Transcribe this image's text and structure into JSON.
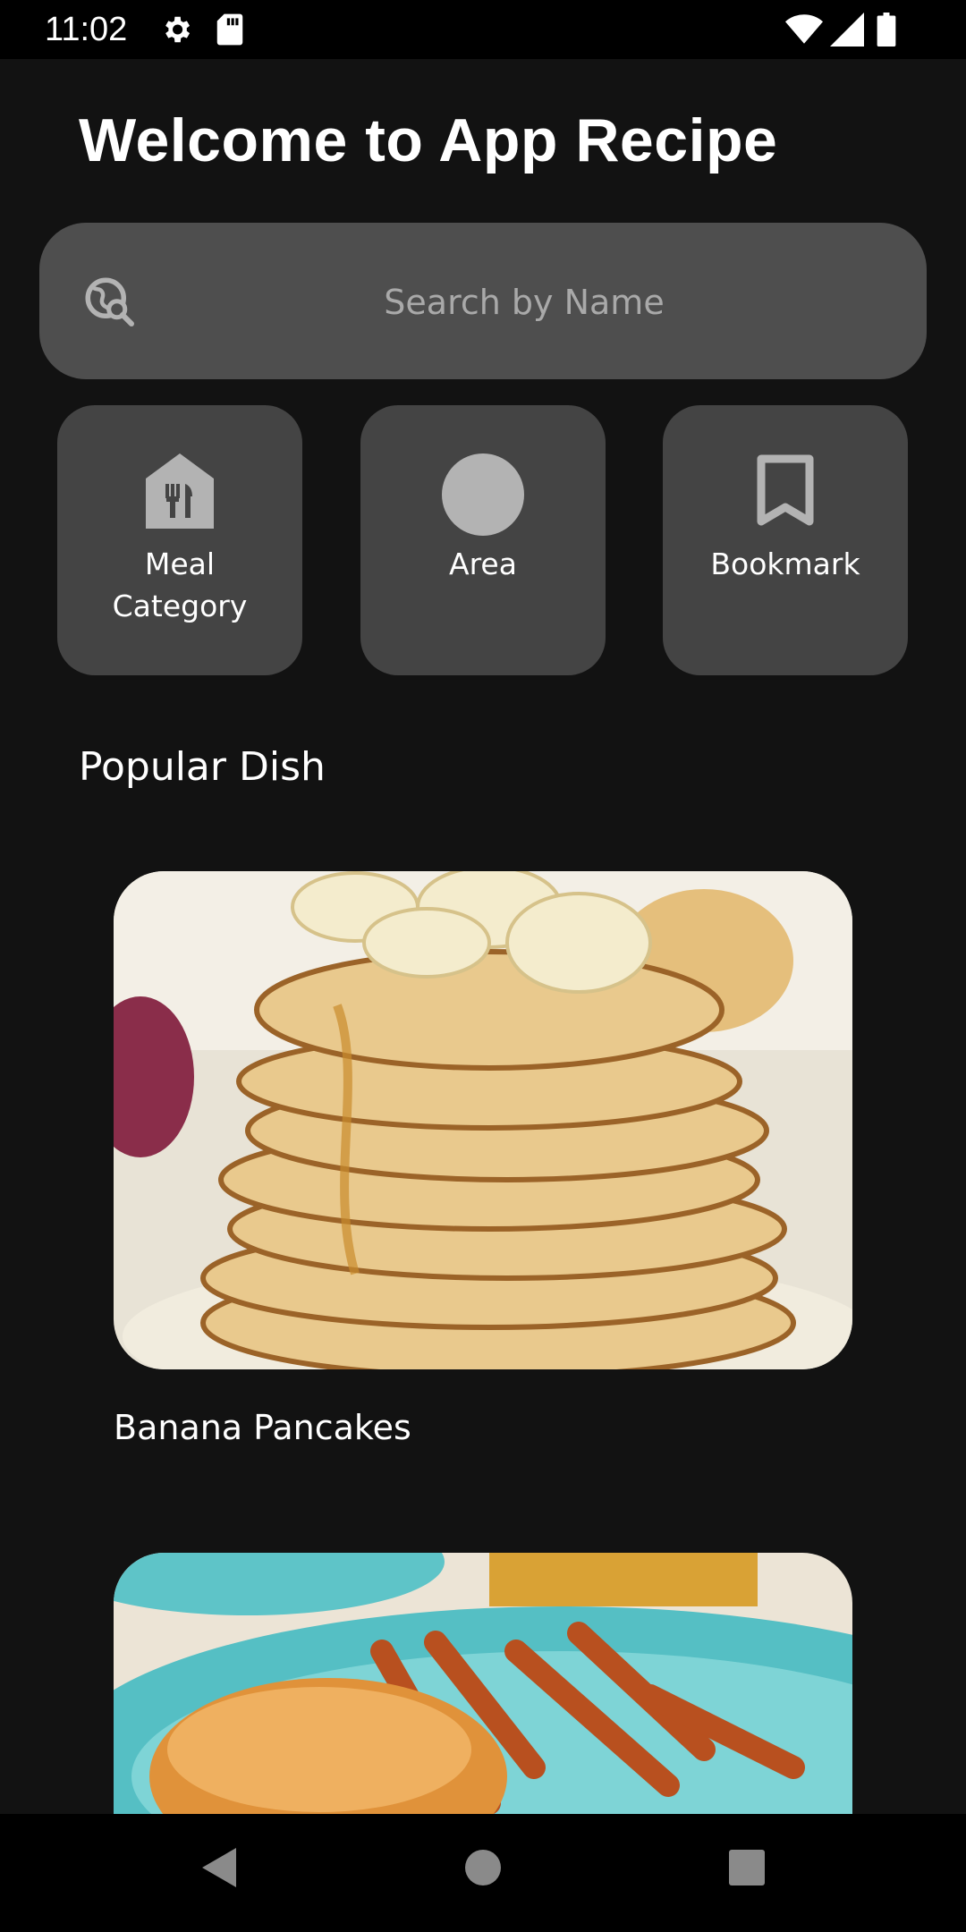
{
  "status_bar": {
    "time": "11:02",
    "icons": [
      "gear-icon",
      "sd-card-icon",
      "wifi-icon",
      "signal-icon",
      "battery-icon"
    ]
  },
  "header": {
    "title": "Welcome to App Recipe"
  },
  "search": {
    "placeholder": "Search by Name",
    "icon": "search-globe-icon"
  },
  "tiles": [
    {
      "label": "Meal\nCategory",
      "icon": "restaurant-house-icon"
    },
    {
      "label": "Area",
      "icon": "circle-icon"
    },
    {
      "label": "Bookmark",
      "icon": "bookmark-icon"
    }
  ],
  "popular": {
    "title": "Popular Dish",
    "dishes": [
      {
        "name": "Banana Pancakes"
      },
      {
        "name": ""
      }
    ]
  },
  "nav": {
    "icons": [
      "back-icon",
      "home-icon",
      "recents-icon"
    ]
  },
  "colors": {
    "background": "#121212",
    "search_bg": "#4e4e4e",
    "tile_bg": "#444444",
    "icon_gray": "#b3b3b3"
  }
}
